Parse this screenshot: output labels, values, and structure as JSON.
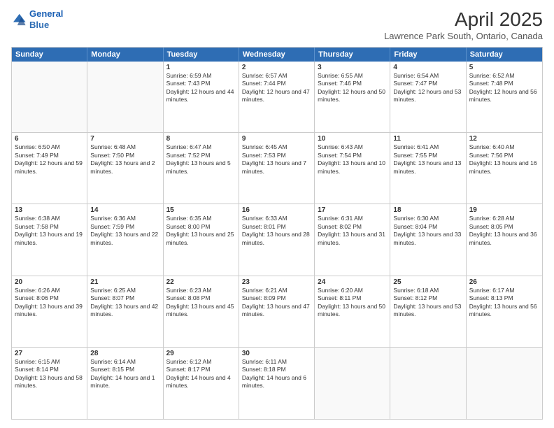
{
  "logo": {
    "line1": "General",
    "line2": "Blue"
  },
  "title": "April 2025",
  "subtitle": "Lawrence Park South, Ontario, Canada",
  "header_days": [
    "Sunday",
    "Monday",
    "Tuesday",
    "Wednesday",
    "Thursday",
    "Friday",
    "Saturday"
  ],
  "weeks": [
    [
      {
        "day": "",
        "text": ""
      },
      {
        "day": "",
        "text": ""
      },
      {
        "day": "1",
        "text": "Sunrise: 6:59 AM\nSunset: 7:43 PM\nDaylight: 12 hours and 44 minutes."
      },
      {
        "day": "2",
        "text": "Sunrise: 6:57 AM\nSunset: 7:44 PM\nDaylight: 12 hours and 47 minutes."
      },
      {
        "day": "3",
        "text": "Sunrise: 6:55 AM\nSunset: 7:46 PM\nDaylight: 12 hours and 50 minutes."
      },
      {
        "day": "4",
        "text": "Sunrise: 6:54 AM\nSunset: 7:47 PM\nDaylight: 12 hours and 53 minutes."
      },
      {
        "day": "5",
        "text": "Sunrise: 6:52 AM\nSunset: 7:48 PM\nDaylight: 12 hours and 56 minutes."
      }
    ],
    [
      {
        "day": "6",
        "text": "Sunrise: 6:50 AM\nSunset: 7:49 PM\nDaylight: 12 hours and 59 minutes."
      },
      {
        "day": "7",
        "text": "Sunrise: 6:48 AM\nSunset: 7:50 PM\nDaylight: 13 hours and 2 minutes."
      },
      {
        "day": "8",
        "text": "Sunrise: 6:47 AM\nSunset: 7:52 PM\nDaylight: 13 hours and 5 minutes."
      },
      {
        "day": "9",
        "text": "Sunrise: 6:45 AM\nSunset: 7:53 PM\nDaylight: 13 hours and 7 minutes."
      },
      {
        "day": "10",
        "text": "Sunrise: 6:43 AM\nSunset: 7:54 PM\nDaylight: 13 hours and 10 minutes."
      },
      {
        "day": "11",
        "text": "Sunrise: 6:41 AM\nSunset: 7:55 PM\nDaylight: 13 hours and 13 minutes."
      },
      {
        "day": "12",
        "text": "Sunrise: 6:40 AM\nSunset: 7:56 PM\nDaylight: 13 hours and 16 minutes."
      }
    ],
    [
      {
        "day": "13",
        "text": "Sunrise: 6:38 AM\nSunset: 7:58 PM\nDaylight: 13 hours and 19 minutes."
      },
      {
        "day": "14",
        "text": "Sunrise: 6:36 AM\nSunset: 7:59 PM\nDaylight: 13 hours and 22 minutes."
      },
      {
        "day": "15",
        "text": "Sunrise: 6:35 AM\nSunset: 8:00 PM\nDaylight: 13 hours and 25 minutes."
      },
      {
        "day": "16",
        "text": "Sunrise: 6:33 AM\nSunset: 8:01 PM\nDaylight: 13 hours and 28 minutes."
      },
      {
        "day": "17",
        "text": "Sunrise: 6:31 AM\nSunset: 8:02 PM\nDaylight: 13 hours and 31 minutes."
      },
      {
        "day": "18",
        "text": "Sunrise: 6:30 AM\nSunset: 8:04 PM\nDaylight: 13 hours and 33 minutes."
      },
      {
        "day": "19",
        "text": "Sunrise: 6:28 AM\nSunset: 8:05 PM\nDaylight: 13 hours and 36 minutes."
      }
    ],
    [
      {
        "day": "20",
        "text": "Sunrise: 6:26 AM\nSunset: 8:06 PM\nDaylight: 13 hours and 39 minutes."
      },
      {
        "day": "21",
        "text": "Sunrise: 6:25 AM\nSunset: 8:07 PM\nDaylight: 13 hours and 42 minutes."
      },
      {
        "day": "22",
        "text": "Sunrise: 6:23 AM\nSunset: 8:08 PM\nDaylight: 13 hours and 45 minutes."
      },
      {
        "day": "23",
        "text": "Sunrise: 6:21 AM\nSunset: 8:09 PM\nDaylight: 13 hours and 47 minutes."
      },
      {
        "day": "24",
        "text": "Sunrise: 6:20 AM\nSunset: 8:11 PM\nDaylight: 13 hours and 50 minutes."
      },
      {
        "day": "25",
        "text": "Sunrise: 6:18 AM\nSunset: 8:12 PM\nDaylight: 13 hours and 53 minutes."
      },
      {
        "day": "26",
        "text": "Sunrise: 6:17 AM\nSunset: 8:13 PM\nDaylight: 13 hours and 56 minutes."
      }
    ],
    [
      {
        "day": "27",
        "text": "Sunrise: 6:15 AM\nSunset: 8:14 PM\nDaylight: 13 hours and 58 minutes."
      },
      {
        "day": "28",
        "text": "Sunrise: 6:14 AM\nSunset: 8:15 PM\nDaylight: 14 hours and 1 minute."
      },
      {
        "day": "29",
        "text": "Sunrise: 6:12 AM\nSunset: 8:17 PM\nDaylight: 14 hours and 4 minutes."
      },
      {
        "day": "30",
        "text": "Sunrise: 6:11 AM\nSunset: 8:18 PM\nDaylight: 14 hours and 6 minutes."
      },
      {
        "day": "",
        "text": ""
      },
      {
        "day": "",
        "text": ""
      },
      {
        "day": "",
        "text": ""
      }
    ]
  ]
}
